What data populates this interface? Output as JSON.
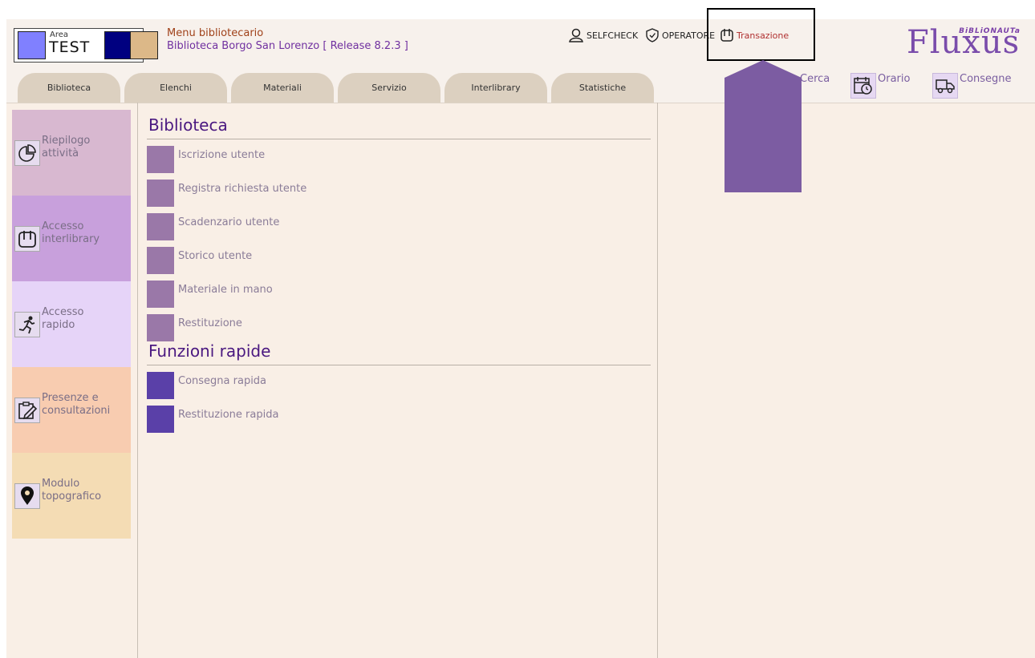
{
  "header": {
    "area_small": "Area",
    "area_big": "TEST",
    "menu_title": "Menu bibliotecario",
    "menu_subtitle": "Biblioteca Borgo San Lorenzo [ Release 8.2.3 ]",
    "top_links": {
      "selfcheck": "SELFCHECK",
      "operatore": "OPERATORE",
      "transazione": "Transazione"
    },
    "logo": {
      "small": "BiBLiONAUTa",
      "big": "Fluxus"
    }
  },
  "tabs": [
    "Biblioteca",
    "Elenchi",
    "Materiali",
    "Servizio",
    "Interlibrary",
    "Statistiche"
  ],
  "right_links": {
    "cerca": "Cerca",
    "orario": "Orario",
    "consegne": "Consegne"
  },
  "sidebar": {
    "items": [
      {
        "line1": "Riepilogo",
        "line2": "attività",
        "icon": "pie-chart-icon",
        "color": "#d8b8d0"
      },
      {
        "line1": "Accesso",
        "line2": "interlibrary",
        "icon": "interlibrary-icon",
        "color": "#c8a0dc"
      },
      {
        "line1": "Accesso",
        "line2": "rapido",
        "icon": "runner-icon",
        "color": "#e6d4f8"
      },
      {
        "line1": "Presenze e",
        "line2": "consultazioni",
        "icon": "edit-icon",
        "color": "#f8ccb0"
      },
      {
        "line1": "Modulo",
        "line2": "topografico",
        "icon": "map-pin-icon",
        "color": "#f4dcb4"
      }
    ]
  },
  "main": {
    "section1_title": "Biblioteca",
    "section1_items": [
      "Iscrizione utente",
      "Registra richiesta utente",
      "Scadenzario utente",
      "Storico utente",
      "Materiale in mano",
      "Restituzione"
    ],
    "section2_title": "Funzioni rapide",
    "section2_items": [
      "Consegna rapida",
      "Restituzione rapida"
    ]
  },
  "colors": {
    "background": "#f9efe6",
    "tab": "#dcd0c0",
    "section_title": "#4a1880",
    "annotation_arrow": "#7c5ca2"
  }
}
